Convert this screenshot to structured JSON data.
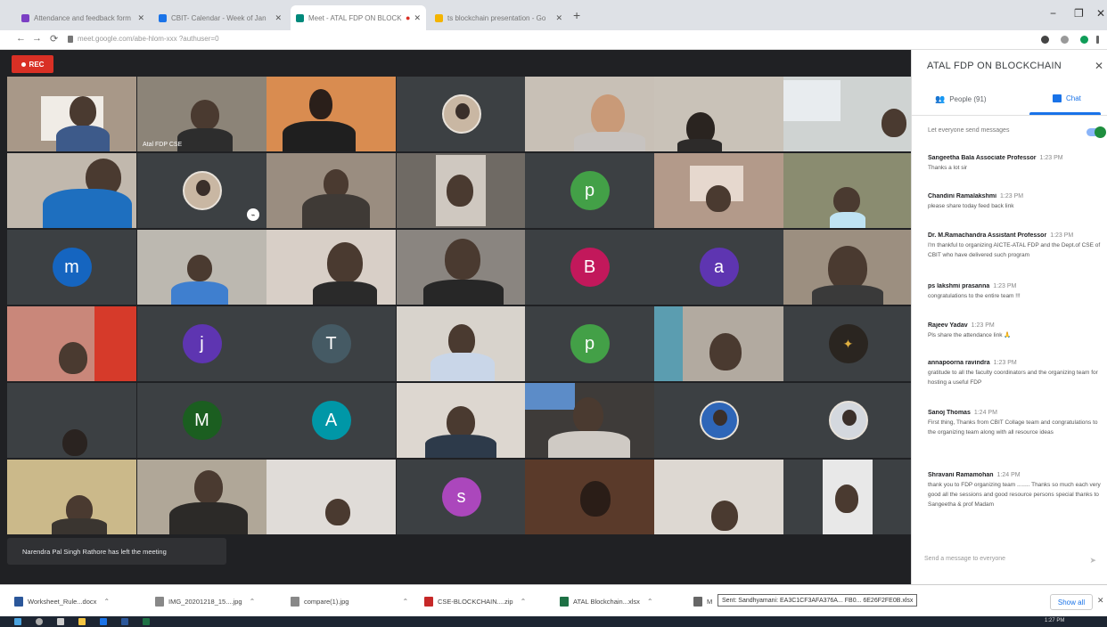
{
  "browser": {
    "tabs": [
      {
        "title": "Attendance and feedback form",
        "fav": "#7b3fc4"
      },
      {
        "title": "CBIT- Calendar - Week of Jan",
        "fav": "#1a73e8"
      },
      {
        "title": "Meet - ATAL FDP ON BLOCK",
        "fav": "#00897b",
        "active": true
      },
      {
        "title": "ts blockchain presentation - Go",
        "fav": "#f4b400"
      }
    ],
    "new_tab": "+",
    "url": "meet.google.com/abe-hlom-xxx ?authuser=0",
    "back": "←",
    "forward": "→",
    "reload": "⟳"
  },
  "meet": {
    "rec_label": "REC",
    "presenter_label": "Atal FDP CSE",
    "toast": "Narendra Pal Singh Rathore has left the meeting",
    "avatars": {
      "m": {
        "letter": "m",
        "color": "#1565c0"
      },
      "j": {
        "letter": "j",
        "color": "#5e35b1"
      },
      "T": {
        "letter": "T",
        "color": "#455a64"
      },
      "M": {
        "letter": "M",
        "color": "#1b5e20"
      },
      "A": {
        "letter": "A",
        "color": "#0097a7"
      },
      "s": {
        "letter": "s",
        "color": "#ab47bc"
      },
      "B": {
        "letter": "B",
        "color": "#c2185b"
      },
      "a": {
        "letter": "a",
        "color": "#5e35b1"
      },
      "p1": {
        "letter": "p",
        "color": "#43a047"
      },
      "p2": {
        "letter": "p",
        "color": "#43a047"
      }
    }
  },
  "panel": {
    "title": "ATAL FDP ON BLOCKCHAIN",
    "close": "✕",
    "tab_people": "People (91)",
    "tab_chat": "Chat",
    "toggle_label": "Let everyone send messages",
    "messages": [
      {
        "who": "Sangeetha Bala Associate Professor",
        "when": "1:23 PM",
        "text": "Thanks a lot sir"
      },
      {
        "who": "Chandini Ramalakshmi",
        "when": "1:23 PM",
        "text": "please share today feed back link"
      },
      {
        "who": "Dr. M.Ramachandra Assistant Professor",
        "when": "1:23 PM",
        "text": "I'm thankful to organizing AICTE-ATAL FDP and the Dept.of CSE of CBIT who have delivered such program"
      },
      {
        "who": "ps lakshmi prasanna",
        "when": "1:23 PM",
        "text": "congratulations to the entire team !!!"
      },
      {
        "who": "Rajeev Yadav",
        "when": "1:23 PM",
        "text": "Pls share the attendance link 🙏"
      },
      {
        "who": "annapoorna ravindra",
        "when": "1:23 PM",
        "text": "gratitude to all the faculty coordinators and the organizing team for hosting a useful FDP"
      },
      {
        "who": "Sanoj Thomas",
        "when": "1:24 PM",
        "text": "First thing, Thanks from CBIT Collage team and congratulations to the organizing team along with all resource ideas"
      },
      {
        "who": "Shravani Ramamohan",
        "when": "1:24 PM",
        "text": "thank you to FDP organizing team ........ Thanks so much each very good all the sessions and good resource persons special thanks to Sangeetha & prof Madam"
      }
    ],
    "send_placeholder": "Send a message to everyone",
    "send_icon": "➤"
  },
  "downloads": {
    "items": [
      {
        "name": "Worksheet_Rule...docx",
        "color": "#2b579a"
      },
      {
        "name": "IMG_20201218_15....jpg",
        "color": "#888"
      },
      {
        "name": "compare(1).jpg",
        "color": "#888"
      },
      {
        "name": "CSE-BLOCKCHAIN....zip",
        "color": "#c62828"
      },
      {
        "name": "ATAL Blockchain...xlsx",
        "color": "#1e7145"
      },
      {
        "name": "M",
        "color": "#666"
      }
    ],
    "tooltip": "Sent: Sandhyamani: EA3C1CF3AFA376A... FB0... 6E26F2FE0B.xlsx",
    "show_all": "Show all",
    "close": "✕"
  },
  "taskbar": {
    "clock": "1:27 PM"
  }
}
